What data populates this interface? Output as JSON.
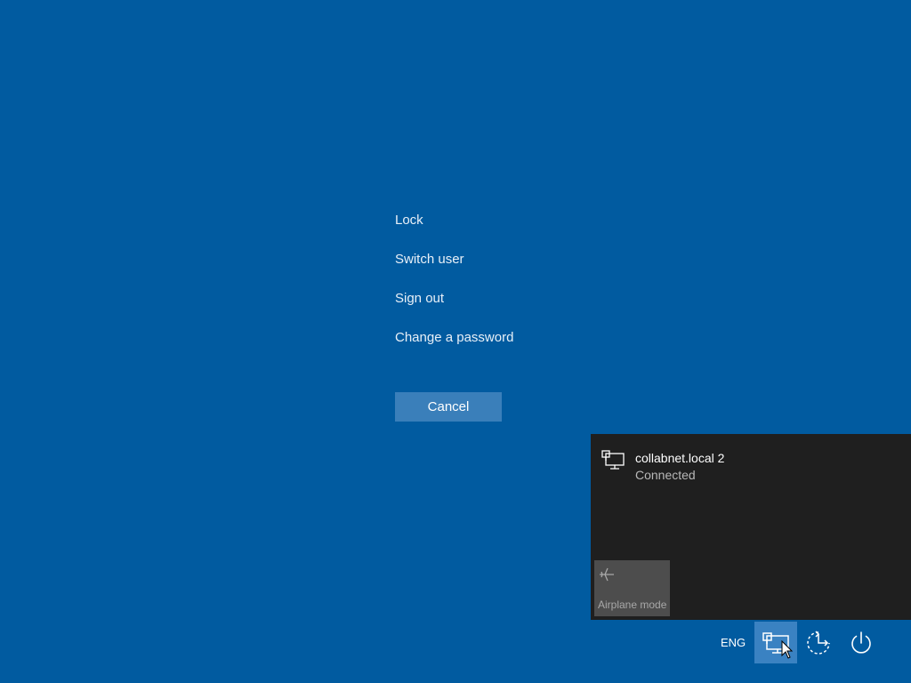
{
  "options_menu": {
    "items": [
      {
        "label": "Lock"
      },
      {
        "label": "Switch user"
      },
      {
        "label": "Sign out"
      },
      {
        "label": "Change a password"
      }
    ],
    "cancel_label": "Cancel"
  },
  "network_flyout": {
    "network": {
      "name": "collabnet.local 2",
      "status": "Connected",
      "icon": "wired-network-icon"
    },
    "quick_actions": [
      {
        "label": "Airplane mode",
        "icon": "airplane-icon",
        "state": "off"
      }
    ]
  },
  "tray": {
    "language": "ENG",
    "buttons": [
      {
        "icon": "network-icon",
        "active": true
      },
      {
        "icon": "ease-of-access-icon"
      },
      {
        "icon": "power-icon"
      }
    ]
  },
  "colors": {
    "background": "#015ba0",
    "cancel_button": "#3a7fba",
    "flyout": "#1f1f1f",
    "tile": "#4d4d4d",
    "active_tray": "#3a82c2"
  }
}
